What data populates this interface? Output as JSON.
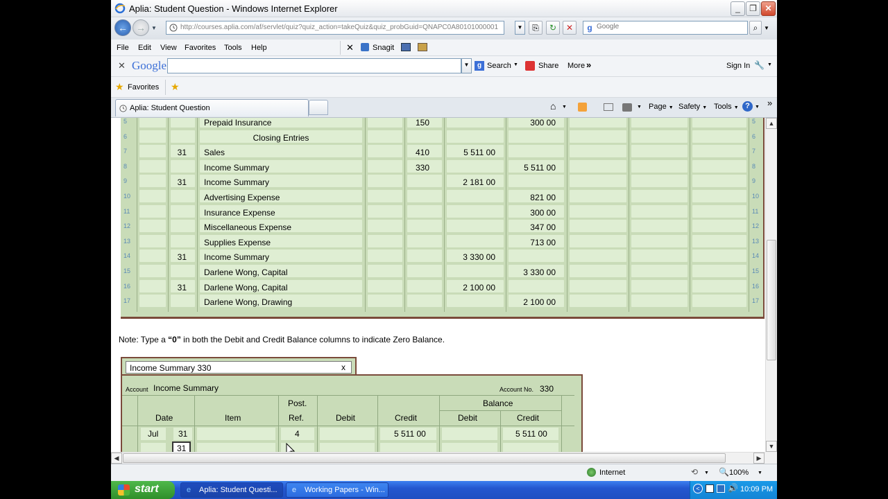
{
  "window": {
    "title": "Aplia: Student Question - Windows Internet Explorer"
  },
  "address": {
    "url": "http://courses.aplia.com/af/servlet/quiz?quiz_action=takeQuiz&quiz_probGuid=QNAPC0A80101000001a",
    "search_placeholder": "Google"
  },
  "menu": {
    "items": [
      "File",
      "Edit",
      "View",
      "Favorites",
      "Tools",
      "Help"
    ],
    "snagit": "Snagit"
  },
  "google_bar": {
    "logo": "Google",
    "search": "Search",
    "share": "Share",
    "more": "More",
    "signin": "Sign In"
  },
  "favorites": {
    "label": "Favorites"
  },
  "tab": {
    "label": "Aplia: Student Question"
  },
  "commands": {
    "page": "Page",
    "safety": "Safety",
    "tools": "Tools"
  },
  "journal": {
    "rows": [
      {
        "num": "5",
        "day": "",
        "desc": "Prepaid Insurance",
        "ref": "150",
        "debit": "",
        "credit": "300 00"
      },
      {
        "num": "6",
        "day": "",
        "desc": "Closing Entries",
        "ref": "",
        "debit": "",
        "credit": "",
        "center": true
      },
      {
        "num": "7",
        "day": "31",
        "desc": "Sales",
        "ref": "410",
        "debit": "5 511 00",
        "credit": ""
      },
      {
        "num": "8",
        "day": "",
        "desc": "Income Summary",
        "ref": "330",
        "debit": "",
        "credit": "5 511 00"
      },
      {
        "num": "9",
        "day": "31",
        "desc": "Income Summary",
        "ref": "",
        "debit": "2 181 00",
        "credit": ""
      },
      {
        "num": "10",
        "day": "",
        "desc": "Advertising Expense",
        "ref": "",
        "debit": "",
        "credit": "821 00"
      },
      {
        "num": "11",
        "day": "",
        "desc": "Insurance Expense",
        "ref": "",
        "debit": "",
        "credit": "300 00"
      },
      {
        "num": "12",
        "day": "",
        "desc": "Miscellaneous Expense",
        "ref": "",
        "debit": "",
        "credit": "347 00"
      },
      {
        "num": "13",
        "day": "",
        "desc": "Supplies Expense",
        "ref": "",
        "debit": "",
        "credit": "713 00"
      },
      {
        "num": "14",
        "day": "31",
        "desc": "Income Summary",
        "ref": "",
        "debit": "3 330 00",
        "credit": ""
      },
      {
        "num": "15",
        "day": "",
        "desc": "Darlene Wong, Capital",
        "ref": "",
        "debit": "",
        "credit": "3 330 00"
      },
      {
        "num": "16",
        "day": "31",
        "desc": "Darlene Wong, Capital",
        "ref": "",
        "debit": "2 100 00",
        "credit": ""
      },
      {
        "num": "17",
        "day": "",
        "desc": "Darlene Wong, Drawing",
        "ref": "",
        "debit": "",
        "credit": "2 100 00"
      }
    ]
  },
  "note": {
    "prefix": "Note: Type a ",
    "zero": "“0”",
    "suffix": " in both the Debit and Credit Balance columns to indicate Zero Balance."
  },
  "ledger": {
    "tab_title": "Income Summary 330",
    "close": "x",
    "account_label": "Account",
    "account_name": "Income Summary",
    "account_no_label": "Account No.",
    "account_no": "330",
    "headers": {
      "date": "Date",
      "item": "Item",
      "post": "Post.",
      "ref": "Ref.",
      "debit": "Debit",
      "credit": "Credit",
      "balance": "Balance",
      "bal_debit": "Debit",
      "bal_credit": "Credit"
    },
    "row1": {
      "month": "Jul",
      "day": "31",
      "ref": "4",
      "debit": "",
      "credit": "5 511 00",
      "bal_debit": "",
      "bal_credit": "5 511 00"
    },
    "row2": {
      "day": "31"
    }
  },
  "status": {
    "zone": "Internet",
    "zoom": "100%"
  },
  "taskbar": {
    "start": "start",
    "task1": "Aplia: Student Questi...",
    "task2": "Working Papers - Win...",
    "clock": "10:09 PM"
  }
}
